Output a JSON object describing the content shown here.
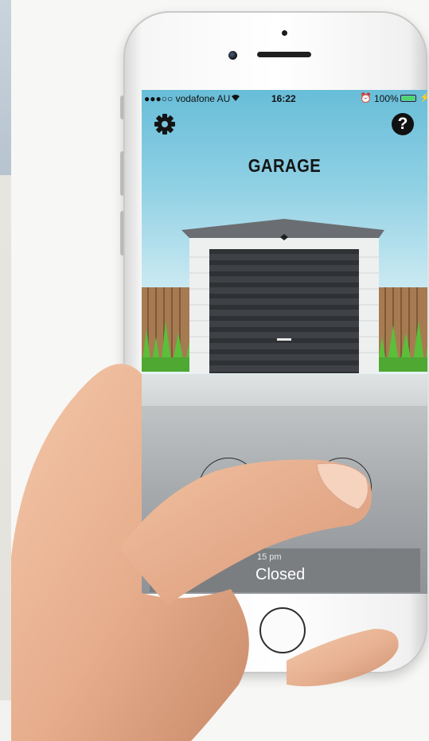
{
  "statusbar": {
    "carrier": "●●●○○ vodafone AU",
    "time": "16:22",
    "battery": "100%"
  },
  "app": {
    "title": "GARAGE",
    "help_label": "?",
    "settings_icon": "gear-icon",
    "help_icon": "question-icon"
  },
  "status_panel": {
    "time": "15 pm",
    "state": "Closed"
  },
  "colors": {
    "sky_top": "#68bdd8",
    "door": "#2f3134",
    "grass": "#5bbf3a",
    "battery": "#4cd964"
  }
}
